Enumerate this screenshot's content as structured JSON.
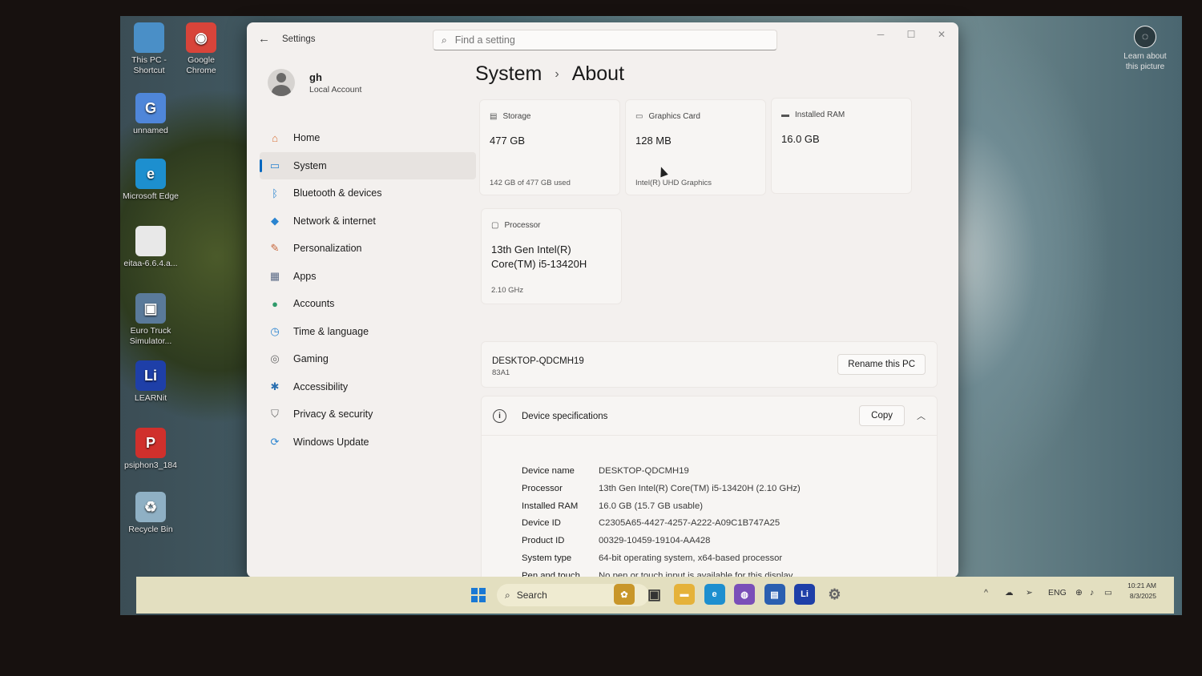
{
  "desktop": {
    "icons": [
      {
        "label": "This PC - Shortcut",
        "glyph": "",
        "color": "#4a8fc7"
      },
      {
        "label": "Google Chrome",
        "glyph": "◉",
        "color": "#d8443a"
      },
      {
        "label": "unnamed",
        "glyph": "G",
        "color": "#4f86d9"
      },
      {
        "label": "Microsoft Edge",
        "glyph": "e",
        "color": "#1d8fcf"
      },
      {
        "label": "eitaa-6.6.4.a...",
        "glyph": "",
        "color": "#e8e8e8"
      },
      {
        "label": "Euro Truck Simulator...",
        "glyph": "▣",
        "color": "#5a7a9a"
      },
      {
        "label": "LEARNit",
        "glyph": "Li",
        "color": "#1e3fa8"
      },
      {
        "label": "psiphon3_184",
        "glyph": "P",
        "color": "#d0302c"
      },
      {
        "label": "Recycle Bin",
        "glyph": "♻",
        "color": "#8fb0c4"
      }
    ],
    "learn_about": "Learn about this picture"
  },
  "window": {
    "app_title": "Settings",
    "search_placeholder": "Find a setting",
    "profile": {
      "name": "gh",
      "type": "Local Account"
    },
    "nav": [
      {
        "label": "Home",
        "icon": "home-icon",
        "glyph": "⌂",
        "color": "#d9733a"
      },
      {
        "label": "System",
        "icon": "monitor-icon",
        "glyph": "▭",
        "color": "#2a84d0"
      },
      {
        "label": "Bluetooth & devices",
        "icon": "bluetooth-icon",
        "glyph": "ᛒ",
        "color": "#2a84d0"
      },
      {
        "label": "Network & internet",
        "icon": "wifi-icon",
        "glyph": "◆",
        "color": "#2a84d0"
      },
      {
        "label": "Personalization",
        "icon": "brush-icon",
        "glyph": "✎",
        "color": "#c7663a"
      },
      {
        "label": "Apps",
        "icon": "apps-icon",
        "glyph": "▦",
        "color": "#5a6a86"
      },
      {
        "label": "Accounts",
        "icon": "person-icon",
        "glyph": "●",
        "color": "#2f9a6a"
      },
      {
        "label": "Time & language",
        "icon": "globe-clock-icon",
        "glyph": "◷",
        "color": "#2a84d0"
      },
      {
        "label": "Gaming",
        "icon": "gamepad-icon",
        "glyph": "◎",
        "color": "#666"
      },
      {
        "label": "Accessibility",
        "icon": "accessibility-icon",
        "glyph": "✱",
        "color": "#2a6fb0"
      },
      {
        "label": "Privacy & security",
        "icon": "shield-icon",
        "glyph": "⛉",
        "color": "#666"
      },
      {
        "label": "Windows Update",
        "icon": "update-icon",
        "glyph": "⟳",
        "color": "#2a84d0"
      }
    ],
    "active_nav": "System",
    "heading": {
      "parent": "System",
      "sep": "›",
      "current": "About"
    },
    "cards": {
      "storage": {
        "label": "Storage",
        "value": "477 GB",
        "sub": "142 GB of 477 GB used"
      },
      "graphics": {
        "label": "Graphics Card",
        "value": "128 MB",
        "sub": "Intel(R) UHD Graphics"
      },
      "ram": {
        "label": "Installed RAM",
        "value": "16.0 GB"
      },
      "processor": {
        "label": "Processor",
        "value_line1": "13th Gen Intel(R)",
        "value_line2": "Core(TM) i5-13420H",
        "sub": "2.10 GHz"
      }
    },
    "pc": {
      "name": "DESKTOP-QDCMH19",
      "model": "83A1",
      "rename_label": "Rename this PC"
    },
    "specs": {
      "title": "Device specifications",
      "copy_label": "Copy",
      "rows": [
        {
          "k": "Device name",
          "v": "DESKTOP-QDCMH19"
        },
        {
          "k": "Processor",
          "v": "13th Gen Intel(R) Core(TM) i5-13420H (2.10 GHz)"
        },
        {
          "k": "Installed RAM",
          "v": "16.0 GB (15.7 GB usable)"
        },
        {
          "k": "Device ID",
          "v": "C2305A65-4427-4257-A222-A09C1B747A25"
        },
        {
          "k": "Product ID",
          "v": "00329-10459-19104-AA428"
        },
        {
          "k": "System type",
          "v": "64-bit operating system, x64-based processor"
        },
        {
          "k": "Pen and touch",
          "v": "No pen or touch input is available for this display"
        }
      ]
    }
  },
  "taskbar": {
    "search_label": "Search",
    "language": "ENG",
    "time": "10:21 AM",
    "date": "8/3/2025",
    "apps": [
      {
        "name": "widgets-flower-icon",
        "glyph": "✿",
        "color": "#c8962a"
      },
      {
        "name": "task-view-icon",
        "glyph": "▣",
        "color": "#333"
      },
      {
        "name": "file-explorer-icon",
        "glyph": "▬",
        "color": "#e5b23a"
      },
      {
        "name": "edge-icon",
        "glyph": "e",
        "color": "#1d8fcf"
      },
      {
        "name": "chat-icon",
        "glyph": "◍",
        "color": "#7a4fb8"
      },
      {
        "name": "store-icon",
        "glyph": "▤",
        "color": "#2a5fb0"
      },
      {
        "name": "learnit-icon",
        "glyph": "Li",
        "color": "#1e3fa8"
      },
      {
        "name": "settings-gear-icon",
        "glyph": "⚙",
        "color": "#666"
      }
    ]
  }
}
